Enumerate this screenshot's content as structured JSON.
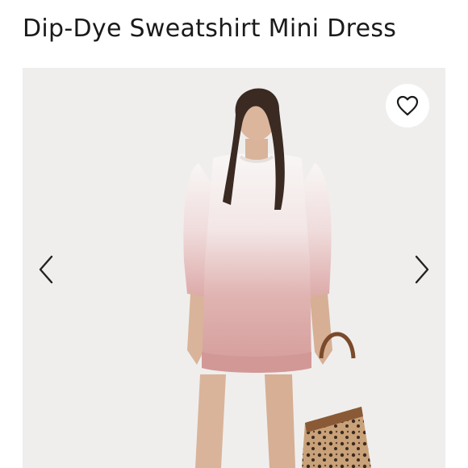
{
  "product": {
    "title": "Dip-Dye Sweatshirt Mini Dress"
  },
  "gallery": {
    "image_subject": "model-wearing-dress",
    "favorite_icon": "heart-outline-icon",
    "prev_icon": "chevron-left-icon",
    "next_icon": "chevron-right-icon"
  },
  "colors": {
    "background": "#efeeed",
    "text": "#1a1a1a",
    "dress_top": "#f7f4f3",
    "dress_bottom": "#d9a6a4"
  }
}
